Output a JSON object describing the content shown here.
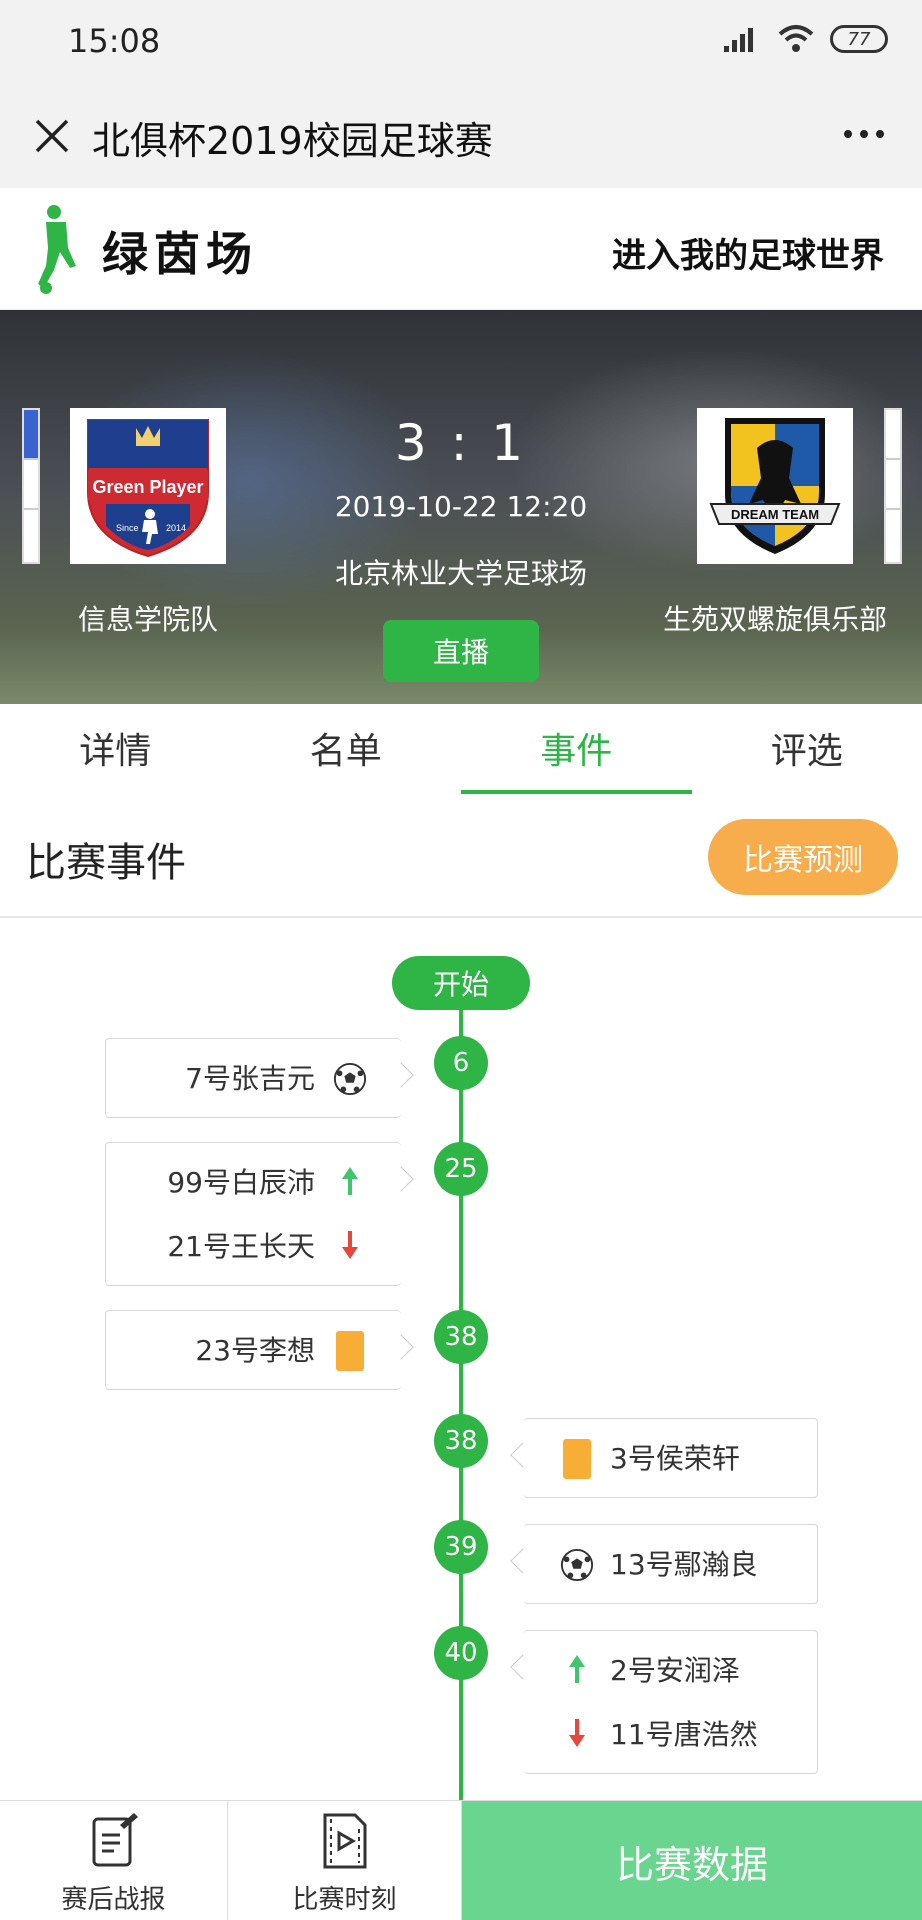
{
  "status_bar": {
    "time": "15:08",
    "battery": "77"
  },
  "nav": {
    "title": "北俱杯2019校园足球赛"
  },
  "brand": {
    "logo_text": "绿茵场",
    "slogan": "进入我的足球世界"
  },
  "match": {
    "score": "3 : 1",
    "datetime": "2019-10-22 12:20",
    "venue": "北京林业大学足球场",
    "live_label": "直播",
    "home_team": {
      "name": "信息学院队",
      "badge_text": "Green Player",
      "badge_since": "Since",
      "badge_year": "2014"
    },
    "away_team": {
      "name": "生苑双螺旋俱乐部",
      "badge_text": "DREAM TEAM"
    }
  },
  "tabs": [
    {
      "label": "详情",
      "active": false
    },
    {
      "label": "名单",
      "active": false
    },
    {
      "label": "事件",
      "active": true
    },
    {
      "label": "评选",
      "active": false
    }
  ],
  "section": {
    "title": "比赛事件",
    "predict_label": "比赛预测"
  },
  "timeline": {
    "start_label": "开始",
    "events": [
      {
        "minute": "6",
        "side": "left",
        "rows": [
          {
            "text": "7号张吉元",
            "icon": "soccer-ball-icon"
          }
        ]
      },
      {
        "minute": "25",
        "side": "left",
        "rows": [
          {
            "text": "99号白辰沛",
            "icon": "sub-in-arrow-icon"
          },
          {
            "text": "21号王长天",
            "icon": "sub-out-arrow-icon"
          }
        ]
      },
      {
        "minute": "38",
        "side": "left",
        "rows": [
          {
            "text": "23号李想",
            "icon": "yellow-card-icon"
          }
        ]
      },
      {
        "minute": "38",
        "side": "right",
        "rows": [
          {
            "text": "3号侯荣轩",
            "icon": "yellow-card-icon"
          }
        ]
      },
      {
        "minute": "39",
        "side": "right",
        "rows": [
          {
            "text": "13号鄢瀚良",
            "icon": "soccer-ball-icon"
          }
        ]
      },
      {
        "minute": "40",
        "side": "right",
        "rows": [
          {
            "text": "2号安润泽",
            "icon": "sub-in-arrow-icon"
          },
          {
            "text": "11号唐浩然",
            "icon": "sub-out-arrow-icon"
          }
        ]
      }
    ]
  },
  "bottom_bar": {
    "report_label": "赛后战报",
    "moments_label": "比赛时刻",
    "data_label": "比赛数据"
  },
  "colors": {
    "accent_green": "#2fb446",
    "predict_orange": "#f7ad4b",
    "yellow_card": "#f7ad36",
    "sub_in": "#3fc66a",
    "sub_out": "#e8453c",
    "data_button": "#6ad58e"
  }
}
